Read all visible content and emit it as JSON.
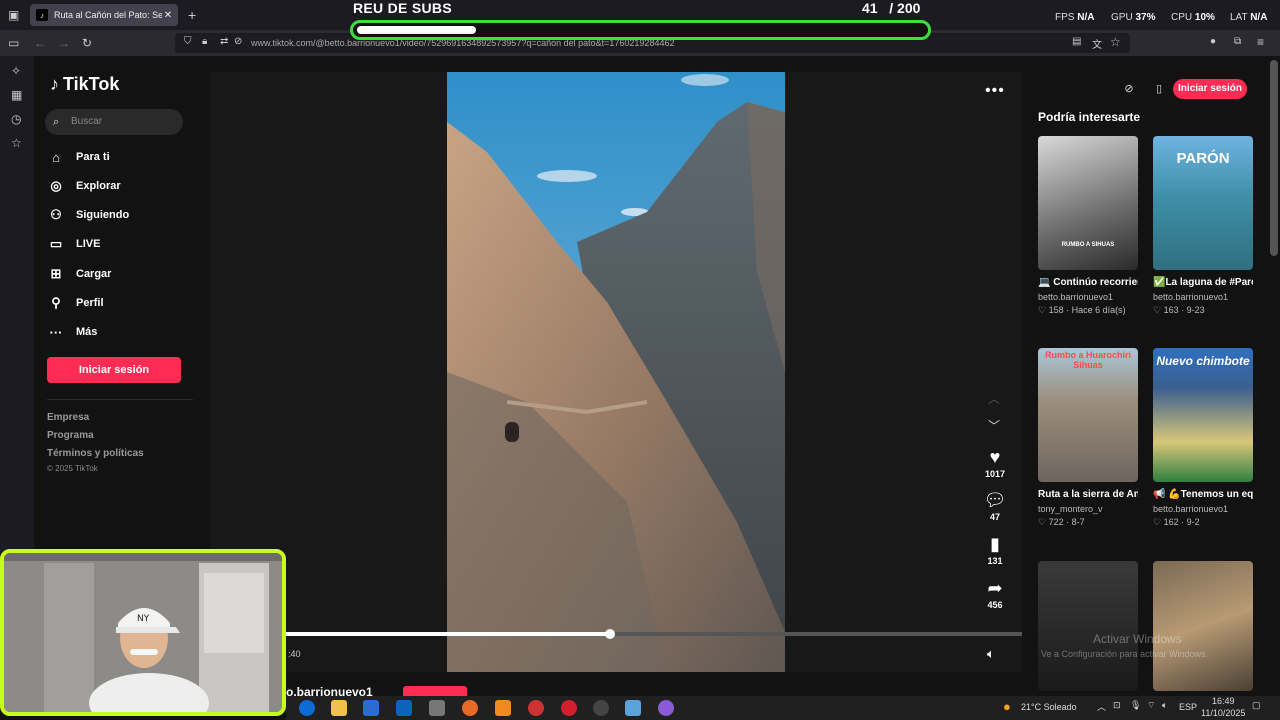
{
  "browser": {
    "tab_title": "Ruta al Cañón del Pato: Se|",
    "url": "www.tiktok.com/@betto.barrionuevo1/video/7529691634892573957?q=cañon del pato&t=1760219284462"
  },
  "overlay": {
    "title": "REU DE SUBS",
    "current": "41",
    "goal": "/ 200",
    "progress": 0.21,
    "fps_label": "FPS",
    "fps_value": "N/A",
    "gpu_label": "GPU",
    "gpu_value": "37%",
    "cpu_label": "CPU",
    "cpu_value": "10%",
    "lat_label": "LAT",
    "lat_value": "N/A"
  },
  "tiktok": {
    "logo": "TikTok",
    "search_placeholder": "Buscar",
    "nav": [
      {
        "label": "Para ti",
        "icon": "home-icon"
      },
      {
        "label": "Explorar",
        "icon": "compass-icon"
      },
      {
        "label": "Siguiendo",
        "icon": "following-icon"
      },
      {
        "label": "LIVE",
        "icon": "live-icon"
      },
      {
        "label": "Cargar",
        "icon": "upload-icon"
      },
      {
        "label": "Perfil",
        "icon": "profile-icon"
      },
      {
        "label": "Más",
        "icon": "more-icon"
      }
    ],
    "login_button": "Iniciar sesión",
    "footer": [
      "Empresa",
      "Programa",
      "Términos y políticas"
    ],
    "copyright": "© 2025 TikTok"
  },
  "video": {
    "likes": "1017",
    "comments": "47",
    "saves": "131",
    "shares": "456",
    "time": ":40",
    "progress": 0.44,
    "author": "o.barrionuevo1"
  },
  "suggestions": {
    "title": "Podría interesarte",
    "login_button": "Iniciar sesión",
    "cards": [
      {
        "caption": "💻 Continúo recorriendo nuestr...",
        "author": "betto.barrionuevo1",
        "likes": "158",
        "date": "Hace 6 día(s)",
        "overlay": "RUMBO A SIHUAS"
      },
      {
        "caption": "✅La laguna de #Parón una joya...",
        "author": "betto.barrionuevo1",
        "likes": "163",
        "date": "9-23",
        "overlay": "PARÓN"
      },
      {
        "caption": "Ruta a la sierra de Ancash #camionet...",
        "author": "tony_montero_v",
        "likes": "722",
        "date": "8-7",
        "overlay": "Rumbo a Huarochiri Sihuas"
      },
      {
        "caption": "📢 💪Tenemos un equipo sólido en...",
        "author": "betto.barrionuevo1",
        "likes": "162",
        "date": "9-2",
        "overlay": "Nuevo chimbote"
      }
    ]
  },
  "windows": {
    "activate_title": "Activar Windows",
    "activate_text": "Ve a Configuración para activar Windows.",
    "weather": "21°C Soleado",
    "lang": "ESP",
    "time": "16:49",
    "date": "11/10/2025"
  }
}
